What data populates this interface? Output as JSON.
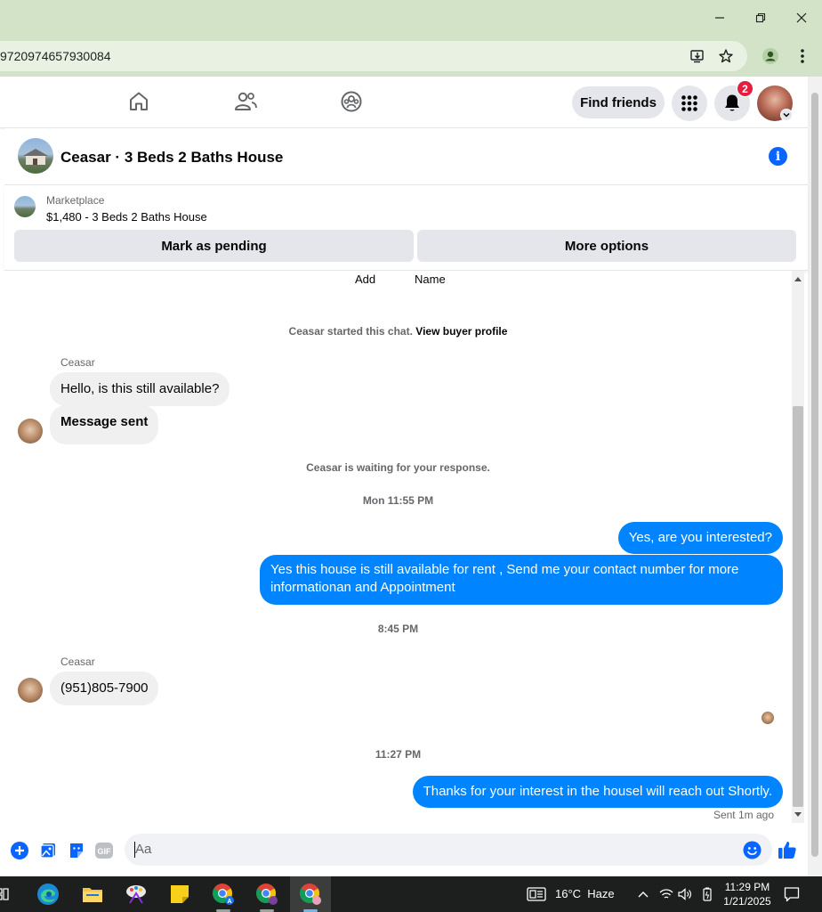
{
  "browser": {
    "url_fragment": "9720974657930084"
  },
  "fb_nav": {
    "find_friends_label": "Find friends",
    "notification_count": "2"
  },
  "chat_header": {
    "title": "Ceasar · 3 Beds 2 Baths House"
  },
  "listing": {
    "source": "Marketplace",
    "price_title": "$1,480 - 3 Beds 2 Baths House",
    "mark_pending_label": "Mark as pending",
    "more_options_label": "More options"
  },
  "chat": {
    "top_labels": [
      "Add",
      "Name"
    ],
    "started_text": "Ceasar started this chat.",
    "view_profile_link": "View buyer profile",
    "sender_name": "Ceasar",
    "msg1": "Hello, is this still available?",
    "msg2": "Message sent",
    "waiting_text": "Ceasar is waiting for your response.",
    "ts1": "Mon 11:55 PM",
    "out1": "Yes, are you interested?",
    "out2": "Yes this house is still available for rent , Send me your contact number for more informationan and Appointment",
    "ts2": "8:45 PM",
    "sender_name2": "Ceasar",
    "msg3": "(951)805-7900",
    "ts3": "11:27 PM",
    "out3": "Thanks for your interest in the housel will reach out Shortly.",
    "sent_status": "Sent 1m ago"
  },
  "composer": {
    "placeholder": "Aa",
    "gif_label": "GIF"
  },
  "taskbar": {
    "weather": "16°C  Haze",
    "time": "11:29 PM",
    "date": "1/21/2025"
  },
  "colors": {
    "messenger_blue": "#0084ff",
    "fb_blue": "#0866ff",
    "badge_red": "#e41e3f",
    "chrome_green": "#d3e3c8"
  }
}
